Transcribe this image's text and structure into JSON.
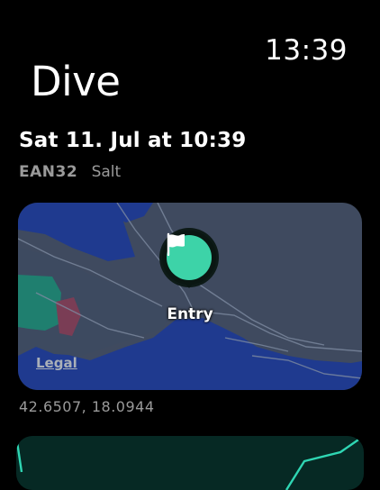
{
  "status": {
    "time": "13:39"
  },
  "header": {
    "title": "Dive"
  },
  "dive": {
    "date": "Sat 11. Jul at 10:39",
    "gas": "EAN32",
    "water": "Salt"
  },
  "map": {
    "pin_label": "Entry",
    "legal_label": "Legal",
    "coordinates": "42.6507, 18.0944"
  },
  "colors": {
    "background": "#000000",
    "accent": "#3dd3a8",
    "map_land": "#3f4a5f",
    "map_water": "#1f3a8f",
    "chart_bg": "#062924",
    "chart_line": "#2fd6b3"
  }
}
